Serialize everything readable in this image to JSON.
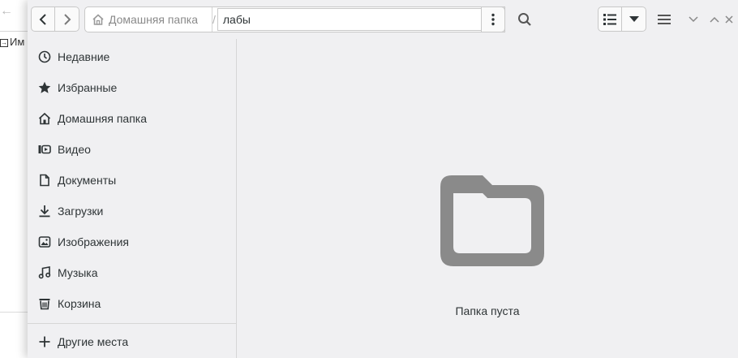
{
  "background_window": {
    "partial_label": "Им"
  },
  "header": {
    "breadcrumb_home": "Домашняя папка",
    "breadcrumb_separator": "/",
    "breadcrumb_current": "лабы"
  },
  "sidebar": {
    "items": [
      {
        "label": "Недавние",
        "icon": "clock-icon"
      },
      {
        "label": "Избранные",
        "icon": "star-icon"
      },
      {
        "label": "Домашняя папка",
        "icon": "home-icon"
      },
      {
        "label": "Видео",
        "icon": "video-icon"
      },
      {
        "label": "Документы",
        "icon": "document-icon"
      },
      {
        "label": "Загрузки",
        "icon": "download-icon"
      },
      {
        "label": "Изображения",
        "icon": "image-icon"
      },
      {
        "label": "Музыка",
        "icon": "music-icon"
      },
      {
        "label": "Корзина",
        "icon": "trash-icon"
      }
    ],
    "other_locations": "Другие места"
  },
  "content": {
    "empty_message": "Папка пуста"
  },
  "colors": {
    "window_bg": "#f0f0f2",
    "icon_gray": "#8a8a8a",
    "text": "#2e3436"
  }
}
